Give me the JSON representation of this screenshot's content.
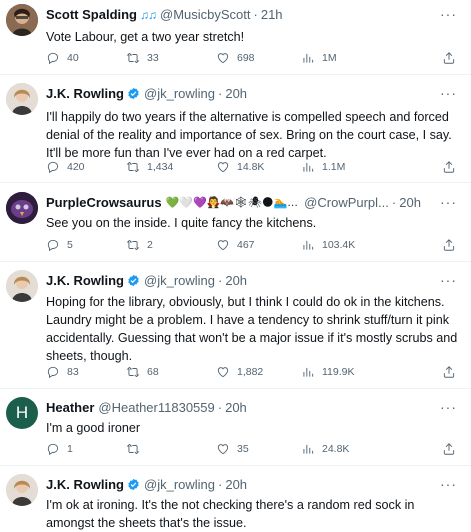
{
  "tweets": [
    {
      "name": "Scott Spalding",
      "badge": "♫♫",
      "handle": "@MusicbyScott",
      "time": "21h",
      "text": "Vote Labour, get a two year stretch!",
      "replies": "40",
      "retweets": "33",
      "likes": "698",
      "views": "1M",
      "avatar_color": "#6b4f3a"
    },
    {
      "name": "J.K. Rowling",
      "handle": "@jk_rowling",
      "time": "20h",
      "text": "I'll happily do two years if the alternative is compelled speech and forced denial of the reality and importance of sex. Bring on the court case, I say. It'll be more fun than I've ever had on a red carpet.",
      "replies": "420",
      "retweets": "1,434",
      "likes": "14.8K",
      "views": "1.1M",
      "avatar_color": "#d9cfc7"
    },
    {
      "name": "PurpleCrowsaurus",
      "emojis": "💚🤍💜🧛🦇🕸🕷🌑🏊…",
      "handle": "@CrowPurpl...",
      "time": "20h",
      "text": "See you on the inside. I quite fancy the kitchens.",
      "replies": "5",
      "retweets": "2",
      "likes": "467",
      "views": "103.4K",
      "avatar_color": "#4a2e5e"
    },
    {
      "name": "J.K. Rowling",
      "handle": "@jk_rowling",
      "time": "20h",
      "text": "Hoping for the library, obviously, but I think I could do ok in the kitchens. Laundry might be a problem. I have a tendency to shrink stuff/turn it pink accidentally. Guessing that won't be a major issue if it's mostly scrubs and sheets, though.",
      "replies": "83",
      "retweets": "68",
      "likes": "1,882",
      "views": "119.9K",
      "avatar_color": "#d9cfc7"
    },
    {
      "name": "Heather",
      "handle": "@Heather11830559",
      "time": "20h",
      "text": "I'm a good ironer",
      "replies": "1",
      "retweets": "",
      "likes": "35",
      "views": "24.8K",
      "avatar_letter": "H",
      "avatar_color": "#1b5e4b"
    },
    {
      "name": "J.K. Rowling",
      "handle": "@jk_rowling",
      "time": "20h",
      "text": "I'm ok at ironing. It's the not checking there's a random red sock in amongst the sheets that's the issue.",
      "avatar_color": "#d9cfc7"
    }
  ],
  "colors": {
    "verified": "#1d9bf0",
    "secondary": "#536471",
    "divider": "#eff3f4"
  },
  "icons": [
    "reply-icon",
    "retweet-icon",
    "like-icon",
    "views-icon",
    "share-icon",
    "verified-badge-icon",
    "more-icon"
  ]
}
